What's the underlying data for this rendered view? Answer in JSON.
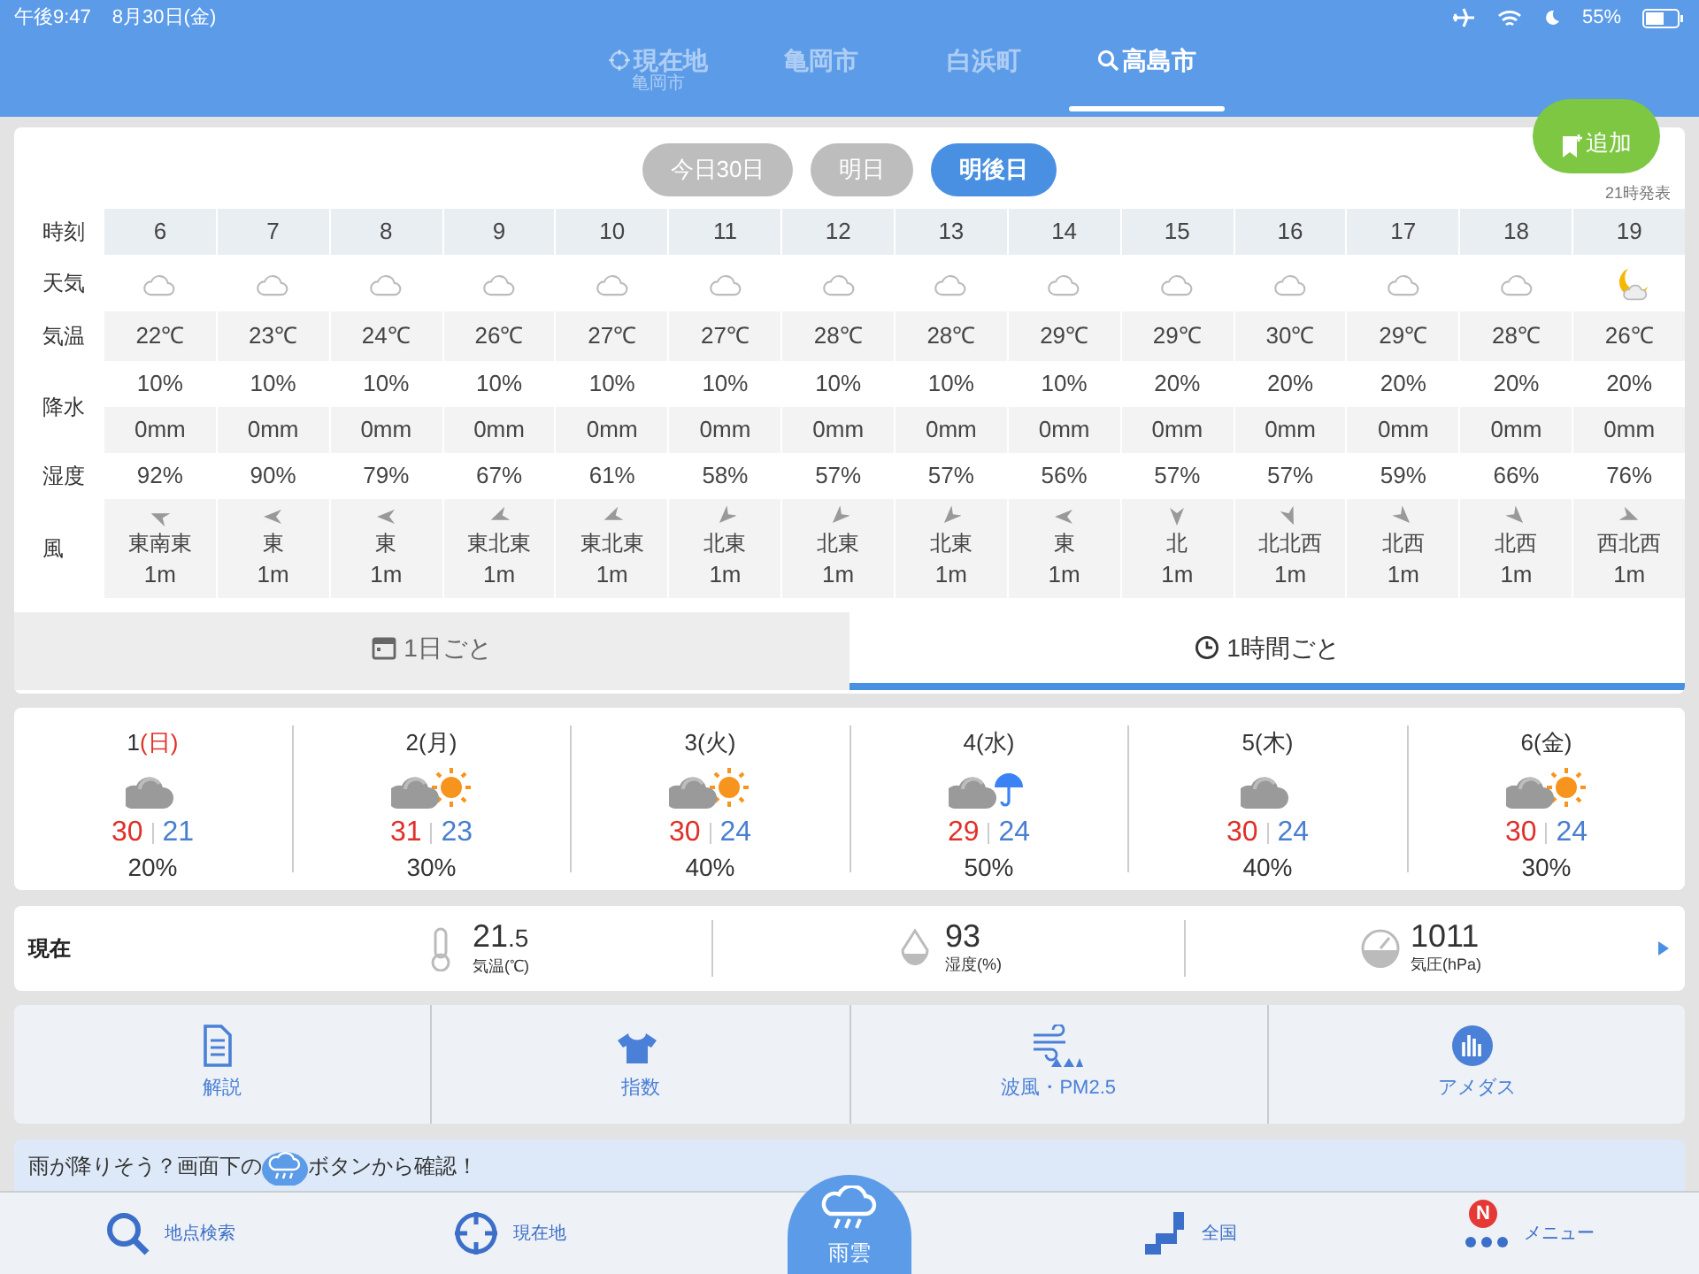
{
  "status_bar": {
    "time": "午後9:47",
    "date": "8月30日(金)",
    "battery": "55%"
  },
  "location_tabs": [
    {
      "kind": "current",
      "label": "現在地",
      "sublabel": "亀岡市",
      "selected": false
    },
    {
      "kind": "city",
      "label": "亀岡市",
      "selected": false
    },
    {
      "kind": "city",
      "label": "白浜町",
      "selected": false
    },
    {
      "kind": "search",
      "label": "高島市",
      "selected": true
    }
  ],
  "add_button": "追加",
  "day_buttons": [
    {
      "label": "今日30日",
      "selected": false
    },
    {
      "label": "明日",
      "selected": false
    },
    {
      "label": "明後日",
      "selected": true
    }
  ],
  "issued": "21時発表",
  "hourly": {
    "labels": {
      "time": "時刻",
      "weather": "天気",
      "temp": "気温",
      "precip": "降水",
      "humidity": "湿度",
      "wind": "風"
    },
    "hours": [
      {
        "hour": "6",
        "kind": "cloud",
        "temp": "22℃",
        "pop": "10%",
        "mm": "0mm",
        "humidity": "92%",
        "wind": {
          "kind": "ese",
          "direction": "東南東",
          "speed": "1m"
        }
      },
      {
        "hour": "7",
        "kind": "cloud",
        "temp": "23℃",
        "pop": "10%",
        "mm": "0mm",
        "humidity": "90%",
        "wind": {
          "kind": "e",
          "direction": "東",
          "speed": "1m"
        }
      },
      {
        "hour": "8",
        "kind": "cloud",
        "temp": "24℃",
        "pop": "10%",
        "mm": "0mm",
        "humidity": "79%",
        "wind": {
          "kind": "e",
          "direction": "東",
          "speed": "1m"
        }
      },
      {
        "hour": "9",
        "kind": "cloud",
        "temp": "26℃",
        "pop": "10%",
        "mm": "0mm",
        "humidity": "67%",
        "wind": {
          "kind": "ene",
          "direction": "東北東",
          "speed": "1m"
        }
      },
      {
        "hour": "10",
        "kind": "cloud",
        "temp": "27℃",
        "pop": "10%",
        "mm": "0mm",
        "humidity": "61%",
        "wind": {
          "kind": "ene",
          "direction": "東北東",
          "speed": "1m"
        }
      },
      {
        "hour": "11",
        "kind": "cloud",
        "temp": "27℃",
        "pop": "10%",
        "mm": "0mm",
        "humidity": "58%",
        "wind": {
          "kind": "ne",
          "direction": "北東",
          "speed": "1m"
        }
      },
      {
        "hour": "12",
        "kind": "cloud",
        "temp": "28℃",
        "pop": "10%",
        "mm": "0mm",
        "humidity": "57%",
        "wind": {
          "kind": "ne",
          "direction": "北東",
          "speed": "1m"
        }
      },
      {
        "hour": "13",
        "kind": "cloud",
        "temp": "28℃",
        "pop": "10%",
        "mm": "0mm",
        "humidity": "57%",
        "wind": {
          "kind": "ne",
          "direction": "北東",
          "speed": "1m"
        }
      },
      {
        "hour": "14",
        "kind": "cloud",
        "temp": "29℃",
        "pop": "10%",
        "mm": "0mm",
        "humidity": "56%",
        "wind": {
          "kind": "e",
          "direction": "東",
          "speed": "1m"
        }
      },
      {
        "hour": "15",
        "kind": "cloud",
        "temp": "29℃",
        "pop": "20%",
        "mm": "0mm",
        "humidity": "57%",
        "wind": {
          "kind": "n",
          "direction": "北",
          "speed": "1m"
        }
      },
      {
        "hour": "16",
        "kind": "cloud",
        "temp": "30℃",
        "pop": "20%",
        "mm": "0mm",
        "humidity": "57%",
        "wind": {
          "kind": "nnw",
          "direction": "北北西",
          "speed": "1m"
        }
      },
      {
        "hour": "17",
        "kind": "cloud",
        "temp": "29℃",
        "pop": "20%",
        "mm": "0mm",
        "humidity": "59%",
        "wind": {
          "kind": "nw",
          "direction": "北西",
          "speed": "1m"
        }
      },
      {
        "hour": "18",
        "kind": "cloud",
        "temp": "28℃",
        "pop": "20%",
        "mm": "0mm",
        "humidity": "66%",
        "wind": {
          "kind": "nw",
          "direction": "北西",
          "speed": "1m"
        }
      },
      {
        "hour": "19",
        "kind": "moon_cloud",
        "temp": "26℃",
        "pop": "20%",
        "mm": "0mm",
        "humidity": "76%",
        "wind": {
          "kind": "wnw",
          "direction": "西北西",
          "speed": "1m"
        }
      }
    ]
  },
  "view_tabs": [
    {
      "kind": "calendar",
      "label": "1日ごと",
      "selected": false
    },
    {
      "kind": "clock",
      "label": "1時間ごと",
      "selected": true
    }
  ],
  "daily": [
    {
      "day": "1",
      "weekday": "(日)",
      "sunday": true,
      "kind": "cloud",
      "high": "30",
      "low": "21",
      "pop": "20%"
    },
    {
      "day": "2",
      "weekday": "(月)",
      "sunday": false,
      "kind": "cloud_sun",
      "high": "31",
      "low": "23",
      "pop": "30%"
    },
    {
      "day": "3",
      "weekday": "(火)",
      "sunday": false,
      "kind": "cloud_sun",
      "high": "30",
      "low": "24",
      "pop": "40%"
    },
    {
      "day": "4",
      "weekday": "(水)",
      "sunday": false,
      "kind": "cloud_rain",
      "high": "29",
      "low": "24",
      "pop": "50%"
    },
    {
      "day": "5",
      "weekday": "(木)",
      "sunday": false,
      "kind": "cloud",
      "high": "30",
      "low": "24",
      "pop": "40%"
    },
    {
      "day": "6",
      "weekday": "(金)",
      "sunday": false,
      "kind": "cloud_sun",
      "high": "30",
      "low": "24",
      "pop": "30%"
    }
  ],
  "current": {
    "label": "現在",
    "items": [
      {
        "kind": "temp",
        "value": "21",
        "fraction": ".5",
        "label": "気温(℃)"
      },
      {
        "kind": "humidity",
        "value": "93",
        "label": "湿度(%)"
      },
      {
        "kind": "pressure",
        "value": "1011",
        "label": "気圧(hPa)"
      }
    ]
  },
  "menu": [
    {
      "kind": "doc",
      "label": "解説"
    },
    {
      "kind": "shirt",
      "label": "指数"
    },
    {
      "kind": "wave",
      "label": "波風・PM2.5"
    },
    {
      "kind": "chart",
      "label": "アメダス"
    }
  ],
  "notice": {
    "before": "雨が降りそう？画面下の",
    "after": "ボタンから確認！"
  },
  "bottom_nav": [
    {
      "kind": "search",
      "label": "地点検索"
    },
    {
      "kind": "target",
      "label": "現在地"
    },
    {
      "kind": "rain",
      "label": "雨雲"
    },
    {
      "kind": "map",
      "label": "全国"
    },
    {
      "kind": "menu",
      "label": "メニュー",
      "badge": "N"
    }
  ]
}
